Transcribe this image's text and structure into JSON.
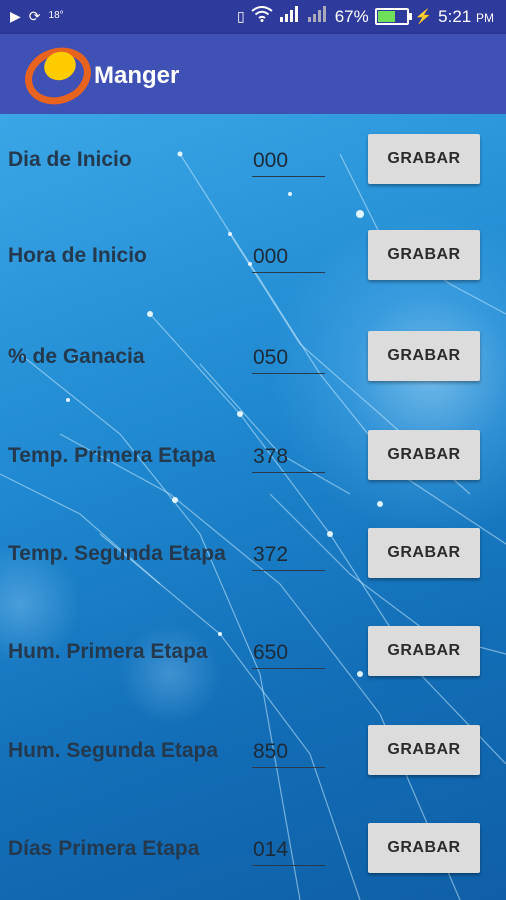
{
  "status_bar": {
    "left_icons": [
      "play-store-icon",
      "sync-icon",
      "weather-icon"
    ],
    "temperature": "18°",
    "battery_percent": "67%",
    "battery_level": 0.67,
    "time": "5:21",
    "ampm": "PM"
  },
  "app": {
    "title": "Manger",
    "logo_colors": [
      "#f5a300",
      "#e8641e",
      "#ffcc00"
    ]
  },
  "button_label": "GRABAR",
  "rows": [
    {
      "label": "Dia de Inicio",
      "value": "000"
    },
    {
      "label": "Hora de Inicio",
      "value": "000"
    },
    {
      "label": "% de Ganacia",
      "value": "050"
    },
    {
      "label": "Temp. Primera Etapa",
      "value": "378"
    },
    {
      "label": "Temp. Segunda Etapa",
      "value": "372"
    },
    {
      "label": "Hum. Primera Etapa",
      "value": "650"
    },
    {
      "label": "Hum. Segunda Etapa",
      "value": "850"
    },
    {
      "label": "Días Primera Etapa",
      "value": "014"
    }
  ]
}
